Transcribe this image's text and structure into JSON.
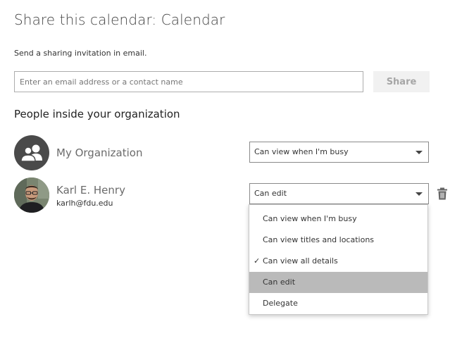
{
  "dialog": {
    "title": "Share this calendar: Calendar",
    "subtitle": "Send a sharing invitation in email.",
    "email_placeholder": "Enter an email address or a contact name",
    "share_label": "Share"
  },
  "people": {
    "heading": "People inside your organization",
    "organization": {
      "name": "My Organization",
      "permission": "Can view when I'm busy",
      "icon": "people-group-icon"
    },
    "user": {
      "name": "Karl E. Henry",
      "email": "karlh@fdu.edu",
      "permission": "Can edit",
      "delete_icon": "trash-icon"
    }
  },
  "permission_menu": {
    "options": [
      "Can view when I'm busy",
      "Can view titles and locations",
      "Can view all details",
      "Can edit",
      "Delegate"
    ],
    "checked_index": 2,
    "highlighted_index": 3,
    "check_glyph": "✓"
  },
  "colors": {
    "org_avatar_bg": "#4a4a4a",
    "highlight_bg": "#bababa",
    "share_disabled_bg": "#f1f1f1",
    "share_disabled_text": "#a6a6a6"
  }
}
